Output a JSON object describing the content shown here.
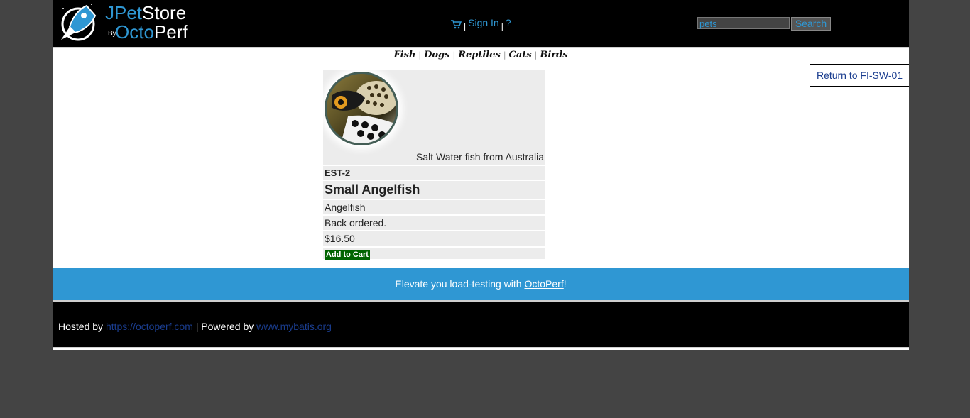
{
  "header": {
    "logo": {
      "j": "J",
      "pet": "Pet",
      "store": "Store",
      "by": "By",
      "octo": "Octo",
      "perf": "Perf"
    },
    "menu": {
      "sign_in": "Sign In",
      "help": "?",
      "separator": "|"
    },
    "search": {
      "value": "pets",
      "button": "Search"
    }
  },
  "quicklinks": [
    "Fish",
    "Dogs",
    "Reptiles",
    "Cats",
    "Birds"
  ],
  "return_link": "Return to FI-SW-01",
  "item": {
    "image_caption": "Salt Water fish from Australia",
    "item_id": "EST-2",
    "name": "Small Angelfish",
    "product": "Angelfish",
    "stock": "Back ordered.",
    "price": "$16.50",
    "add_to_cart": "Add to Cart"
  },
  "banner": {
    "text_before": "Elevate you load-testing with ",
    "link": "OctoPerf",
    "text_after": "!"
  },
  "footer": {
    "hosted_by": "Hosted by",
    "hosted_link": "https://octoperf.com",
    "powered_by": "| Powered by",
    "powered_link": "www.mybatis.org"
  },
  "colors": {
    "accent": "#2f97d3",
    "page_bg": "#444444",
    "cart_button": "#006400",
    "link": "#1a3d8f"
  }
}
